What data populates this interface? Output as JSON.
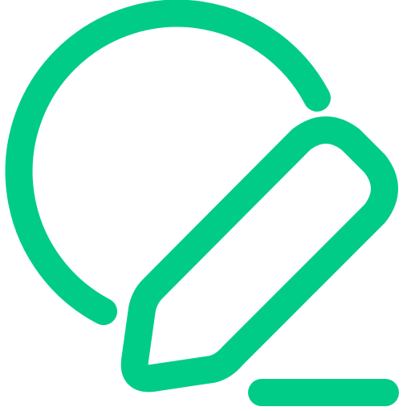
{
  "icon": {
    "name": "edit-circle-icon",
    "color": "#00CC88"
  }
}
